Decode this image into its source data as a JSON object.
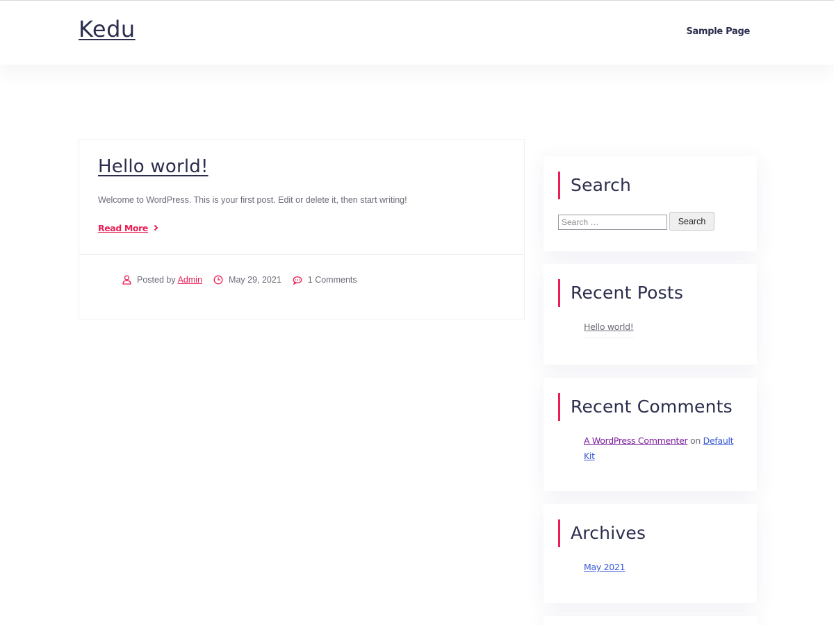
{
  "header": {
    "site_title": "Kedu",
    "nav": [
      "Sample Page"
    ]
  },
  "post": {
    "title": "Hello world!",
    "excerpt": "Welcome to WordPress. This is your first post. Edit or delete it, then start writing!",
    "read_more": "Read More",
    "posted_by_label": "Posted by",
    "author": "Admin",
    "date": "May 29, 2021",
    "comments": "1 Comments"
  },
  "sidebar": {
    "search": {
      "title": "Search",
      "placeholder": "Search …",
      "button": "Search"
    },
    "recent_posts": {
      "title": "Recent Posts",
      "items": [
        "Hello world!"
      ]
    },
    "recent_comments": {
      "title": "Recent Comments",
      "items": [
        {
          "author": "A WordPress Commenter",
          "on": "on",
          "post": "Default Kit"
        }
      ]
    },
    "archives": {
      "title": "Archives",
      "items": [
        "May 2021"
      ]
    }
  },
  "colors": {
    "accent": "#ea1f55",
    "heading": "#2b2d4d",
    "body_text": "#6b6b78",
    "link_blue": "#3858d6",
    "visited_link": "#7a1a9c"
  },
  "icons": [
    "user-icon",
    "clock-icon",
    "comment-icon",
    "chevron-right-icon"
  ]
}
